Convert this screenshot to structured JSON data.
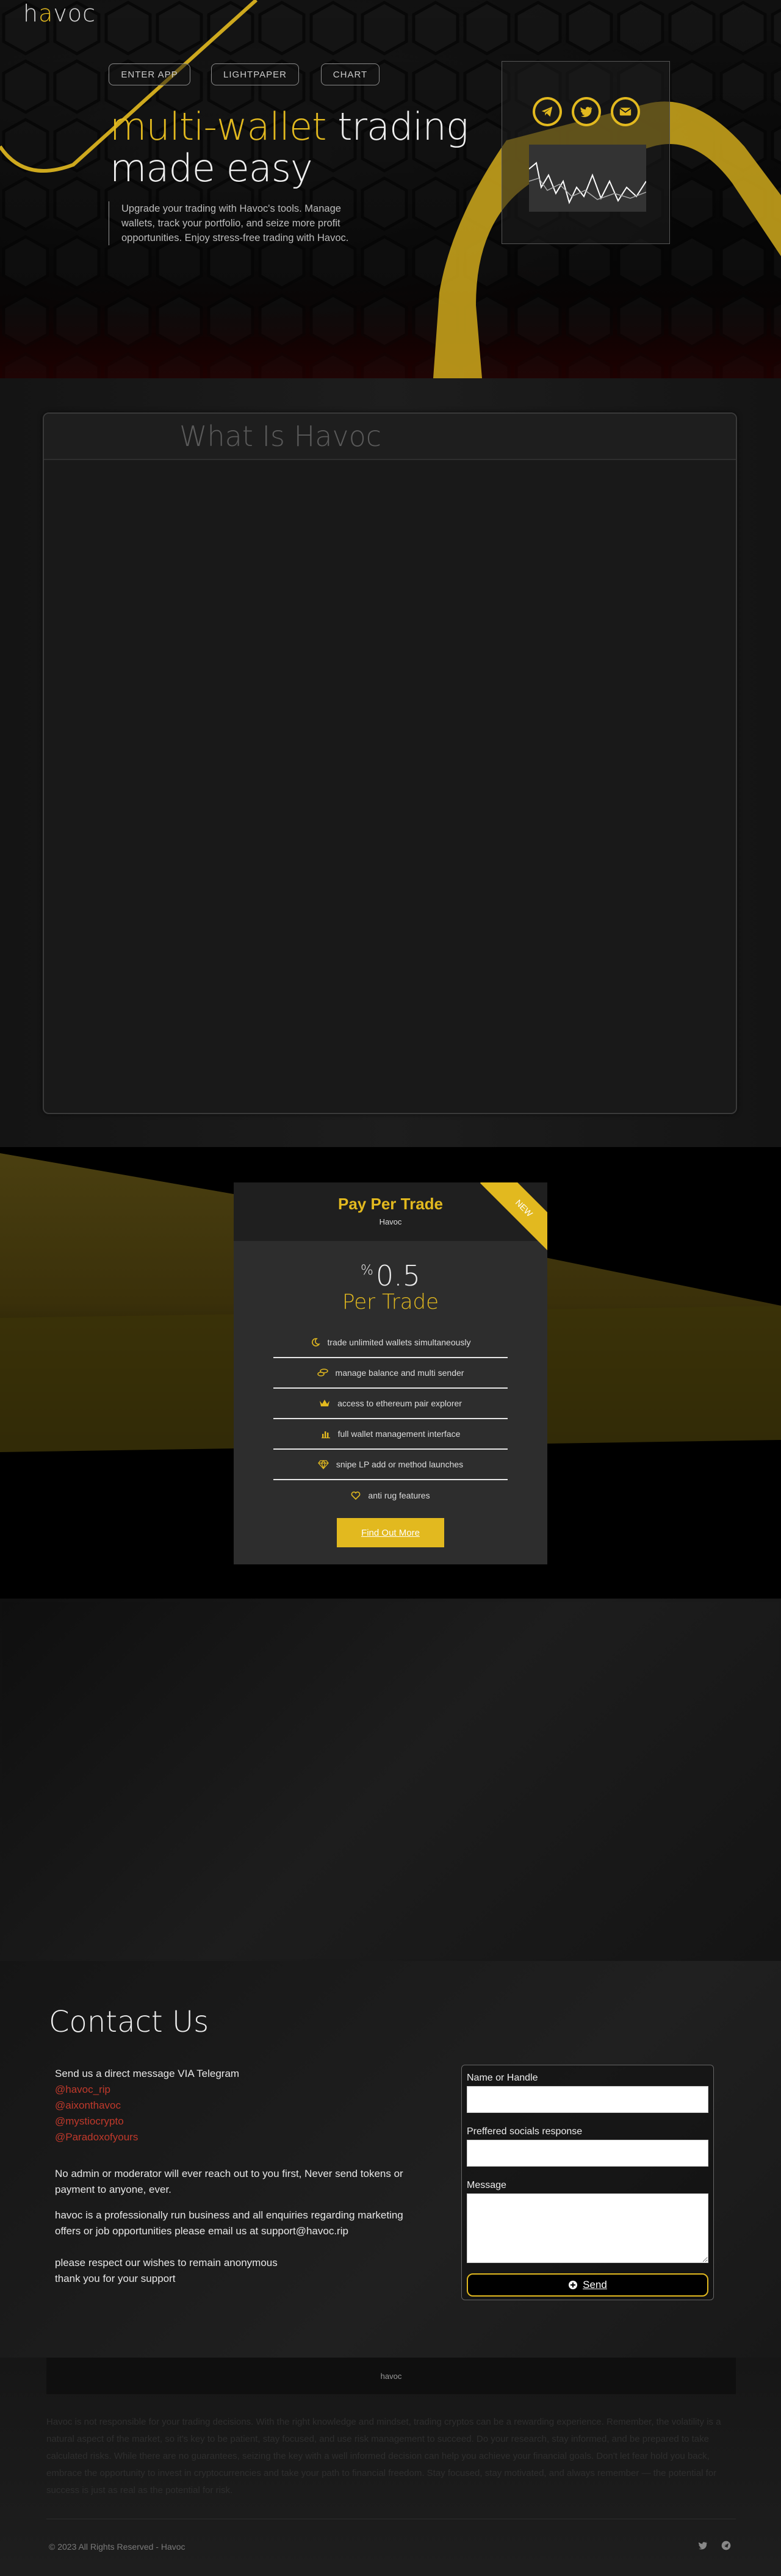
{
  "brand": {
    "logo_text_1": "h",
    "logo_text_2": "a",
    "logo_text_3": "voc"
  },
  "hero": {
    "buttons": [
      "ENTER APP",
      "LIGHTPAPER",
      "CHART"
    ],
    "title_accent": "multi-wallet",
    "title_rest": " trading",
    "title_line2": "made easy",
    "description": "Upgrade your trading with Havoc's tools. Manage wallets, track your portfolio, and seize more profit opportunities. Enjoy stress-free trading with Havoc.",
    "socials": [
      "telegram-icon",
      "twitter-icon",
      "email-icon"
    ]
  },
  "what": {
    "title": "What Is Havoc"
  },
  "pricing": {
    "title": "Pay Per Trade",
    "subtitle": "Havoc",
    "ribbon": "NEW",
    "percent_symbol": "%",
    "amount": "0.5",
    "per": "Per Trade",
    "features": [
      {
        "icon": "moon-icon",
        "text": "trade unlimited wallets simultaneously"
      },
      {
        "icon": "coins-icon",
        "text": "manage balance and multi sender"
      },
      {
        "icon": "crown-icon",
        "text": "access to ethereum pair explorer"
      },
      {
        "icon": "chart-icon",
        "text": "full wallet management interface"
      },
      {
        "icon": "diamond-icon",
        "text": "snipe LP add or method launches"
      },
      {
        "icon": "heart-icon",
        "text": "anti rug features"
      }
    ],
    "button": "Find Out More"
  },
  "contact": {
    "title": "Contact Us",
    "intro": "Send us a direct message VIA Telegram",
    "handles": [
      "@havoc_rip",
      "@aixonthavoc",
      "@mystiocrypto",
      "@Paradoxofyours"
    ],
    "p1": "No admin or moderator will ever reach out to you first, Never send tokens or payment to anyone, ever.",
    "p2": "havoc is a professionally run business and all enquiries regarding marketing offers or job opportunities please email us at support@havoc.rip",
    "p3a": "please respect our wishes to remain anonymous",
    "p3b": "thank you for your support",
    "form": {
      "name_label": "Name or Handle",
      "socials_label": "Preffered socials response",
      "message_label": "Message",
      "send": "Send"
    }
  },
  "footer": {
    "bar": "havoc",
    "desc": "Havoc is not responsible for your trading decisions. With the right knowledge and mindset, trading cryptos can be a rewarding experience. Remember, the volatility is a natural aspect of the market, so it's key to be patient, stay focused, and use risk management to succeed. Do your research, stay informed, and be prepared to take calculated risks. While there are no guarantees, seizing the key with a well informed decision can help you achieve your financial goals. Don't let fear hold you back, embrace the opportunity to invest in cryptocurrencies and take your path to financial freedom. Stay focused, stay motivated, and always remember — the potential for success is just as real as the potential for risk.",
    "copyright": "© 2023 All Rights Reserved - Havoc"
  },
  "colors": {
    "accent": "#e2b91f",
    "handle": "#c0392b"
  }
}
